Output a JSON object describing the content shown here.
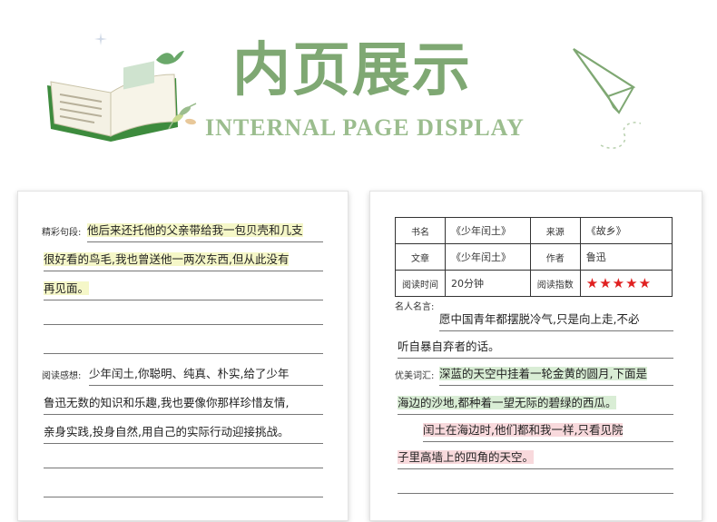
{
  "header": {
    "title_cn": "内页展示",
    "title_en": "INTERNAL PAGE DISPLAY"
  },
  "left_page": {
    "section1_label": "精彩句段:",
    "section1_lines": [
      "他后来还托他的父亲带给我一包贝壳和几支",
      "很好看的鸟毛,我也曾送他一两次东西,但从此没有",
      "再见面。"
    ],
    "section2_label": "阅读感想:",
    "section2_lines": [
      "少年闰土,你聪明、纯真、朴实,给了少年",
      "鲁迅无数的知识和乐趣,我也要像你那样珍惜友情,",
      "亲身实践,投身自然,用自己的实际行动迎接挑战。"
    ]
  },
  "right_page": {
    "table": {
      "book_label": "书名",
      "book_value": "《少年闰土》",
      "source_label": "来源",
      "source_value": "《故乡》",
      "article_label": "文章",
      "article_value": "《少年闰土》",
      "author_label": "作者",
      "author_value": "鲁迅",
      "time_label": "阅读时间",
      "time_value": "20分钟",
      "index_label": "阅读指数",
      "index_stars": "★★★★★",
      "rating": 5
    },
    "quote_label": "名人名言:",
    "quote_lines": [
      "愿中国青年都摆脱冷气,只是向上走,不必",
      "听自暴自弃者的话。"
    ],
    "words_label": "优美词汇:",
    "words_lines": [
      "深蓝的天空中挂着一轮金黄的圆月,下面是",
      "海边的沙地,都种着一望无际的碧绿的西瓜。",
      "闰土在海边时,他们都和我一样,只看见院",
      "子里高墙上的四角的天空。"
    ],
    "accent_green": "#d9edd5",
    "accent_pink": "#f8d9dc",
    "accent_yellow": "#f5f7c8"
  }
}
